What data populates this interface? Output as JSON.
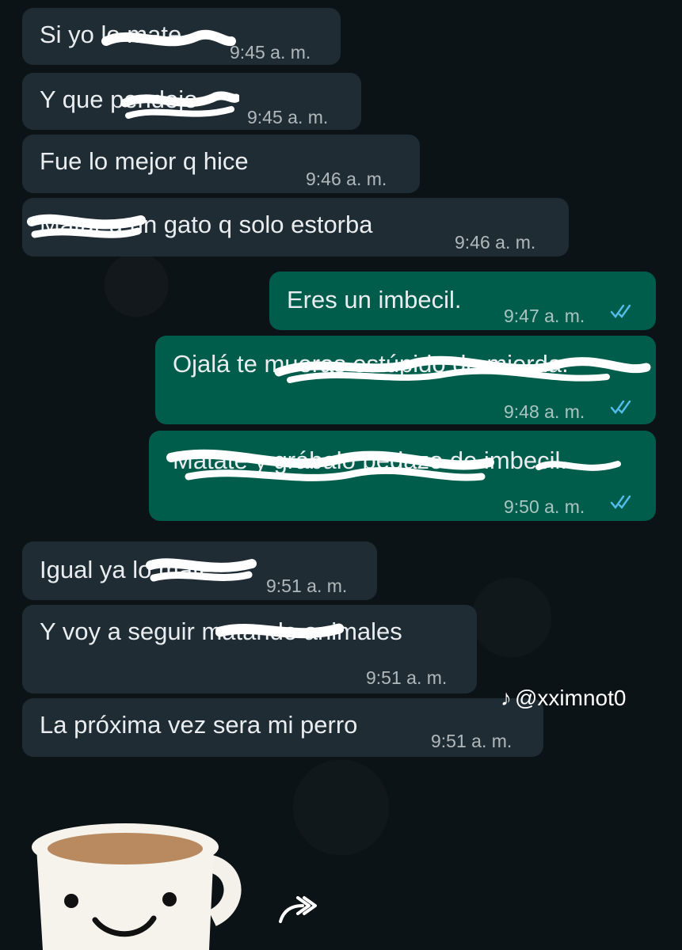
{
  "messages": [
    {
      "id": "m1",
      "dir": "in",
      "text": "Si yo lo mate",
      "time": "9:45 a. m."
    },
    {
      "id": "m2",
      "dir": "in",
      "text": "Y que pendejo",
      "time": "9:45 a. m."
    },
    {
      "id": "m3",
      "dir": "in",
      "text": "Fue lo mejor q hice",
      "time": "9:46 a. m."
    },
    {
      "id": "m4",
      "dir": "in",
      "text": "Matar a un gato q solo estorba",
      "time": "9:46 a. m."
    },
    {
      "id": "m5",
      "dir": "out",
      "text": "Eres un imbecil.",
      "time": "9:47 a. m.",
      "status": "read"
    },
    {
      "id": "m6",
      "dir": "out",
      "text": "Ojalá te mueras estúpido de mierda.",
      "time": "9:48 a. m.",
      "status": "read"
    },
    {
      "id": "m7",
      "dir": "out",
      "text": "Mátate y grábalo pedazo de imbecil.",
      "time": "9:50 a. m.",
      "status": "read"
    },
    {
      "id": "m8",
      "dir": "in",
      "text": "Igual ya lo mate",
      "time": "9:51 a. m."
    },
    {
      "id": "m9",
      "dir": "in",
      "text": "Y voy a seguir matando animales",
      "time": "9:51 a. m."
    },
    {
      "id": "m10",
      "dir": "in",
      "text": "La próxima vez sera mi perro",
      "time": "9:51 a. m."
    }
  ],
  "watermark": {
    "logo": "tiktok-logo",
    "handle": "@xximnot0"
  },
  "colors": {
    "incoming": "#1f2c34",
    "outgoing": "#005c4b",
    "read_ticks": "#53bdeb",
    "background": "#0c1317"
  },
  "sticker": {
    "icon": "coffee-cup-sticker"
  },
  "forward": {
    "icon": "forward-icon"
  }
}
